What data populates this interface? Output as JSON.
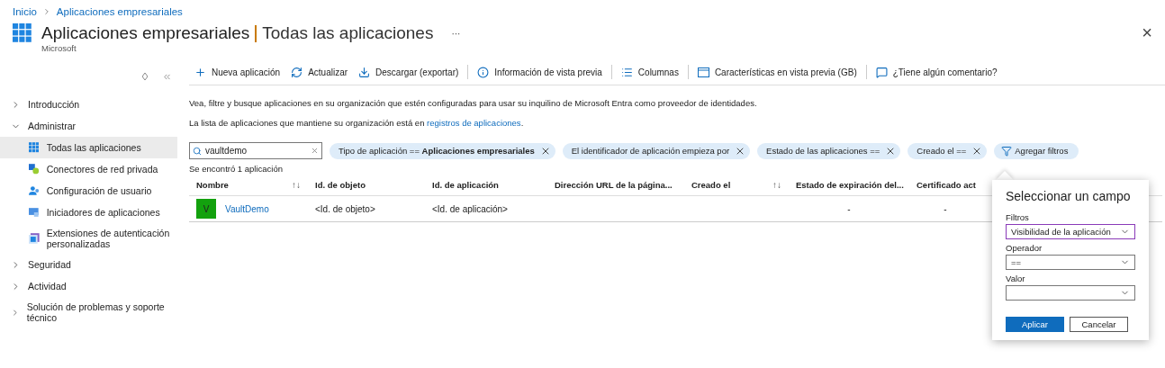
{
  "breadcrumb": [
    "Inicio",
    "Aplicaciones empresariales"
  ],
  "header": {
    "title": "Aplicaciones empresariales",
    "subtitle": "Todas las aplicaciones",
    "more": "···",
    "org": "Microsoft",
    "close": "×"
  },
  "sidebar": {
    "items": [
      {
        "label": "Introducción",
        "expanded": false
      },
      {
        "label": "Administrar",
        "expanded": true,
        "children": [
          {
            "label": "Todas las aplicaciones",
            "selected": true
          },
          {
            "label": "Conectores de red privada",
            "selected": false
          },
          {
            "label": "Configuración de usuario",
            "selected": false
          },
          {
            "label": "Iniciadores de aplicaciones",
            "selected": false
          },
          {
            "label": "Extensiones de autenticación personalizadas",
            "selected": false
          }
        ]
      },
      {
        "label": "Seguridad",
        "expanded": false
      },
      {
        "label": "Actividad",
        "expanded": false
      },
      {
        "label": "Solución de problemas y soporte técnico",
        "expanded": false
      }
    ]
  },
  "toolbar": [
    {
      "kind": "plus",
      "label": "Nueva aplicación"
    },
    {
      "kind": "refresh",
      "label": "Actualizar"
    },
    {
      "kind": "download",
      "label": "Descargar (exportar)"
    },
    {
      "kind": "info",
      "label": "Información de vista previa"
    },
    {
      "kind": "columns",
      "label": "Columnas"
    },
    {
      "kind": "preview",
      "label": "Características en vista previa (GB)"
    },
    {
      "kind": "feedback",
      "label": "¿Tiene algún comentario?"
    }
  ],
  "description": "Vea, filtre y busque aplicaciones en su organización que estén configuradas para usar su inquilino de Microsoft Entra como proveedor de identidades.",
  "registry_note": {
    "text": "La lista de aplicaciones que mantiene su organización está en ",
    "link": "registros de aplicaciones",
    "end": "."
  },
  "search": {
    "value": "vaultdemo"
  },
  "filters": [
    "Tipo de aplicación == **Aplicaciones empresariales**",
    "El identificador de aplicación empieza por",
    "Estado de las aplicaciones ==",
    "Creado el =="
  ],
  "add_filter": "Agregar filtros",
  "result_count": "Se encontró 1 aplicación",
  "table": {
    "columns": [
      {
        "label": "Nombre",
        "sort": "↑↓"
      },
      {
        "label": "Id. de objeto"
      },
      {
        "label": "Id. de aplicación"
      },
      {
        "label": "Dirección URL de la página..."
      },
      {
        "label": "Creado el",
        "sort": "↑↓"
      },
      {
        "label": "Estado de expiración del..."
      },
      {
        "label": "Certificado act"
      }
    ],
    "rows": [
      {
        "avatar": {
          "letter": "V",
          "color": "#13a10e"
        },
        "cells": [
          "VaultDemo",
          "<Id. de objeto>",
          "<Id. de aplicación>",
          "",
          "",
          "-",
          "-"
        ]
      }
    ]
  },
  "popup": {
    "title": "Seleccionar un campo",
    "fields": [
      {
        "label": "Filtros",
        "value": "Visibilidad de la aplicación",
        "focused": true
      },
      {
        "label": "Operador",
        "value": "==",
        "focused": false
      },
      {
        "label": "Valor",
        "focused": false
      }
    ],
    "buttons": [
      {
        "label": "Aplicar",
        "primary": true
      },
      {
        "label": "Cancelar",
        "primary": false
      }
    ]
  }
}
